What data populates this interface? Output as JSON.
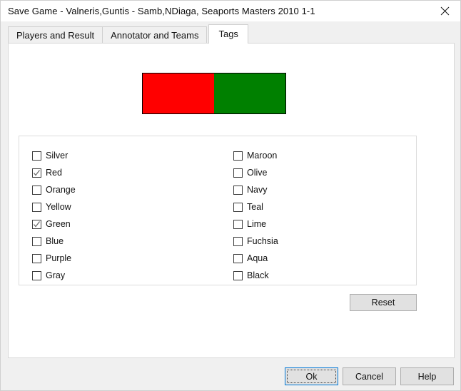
{
  "window": {
    "title": "Save Game - Valneris,Guntis - Samb,NDiaga, Seaports Masters 2010 1-1",
    "close_icon": "close-icon"
  },
  "tabs": [
    {
      "label": "Players and Result",
      "selected": false
    },
    {
      "label": "Annotator and Teams",
      "selected": false
    },
    {
      "label": "Tags",
      "selected": true
    }
  ],
  "preview": {
    "left_color": "#FF0000",
    "right_color": "#008000",
    "border_color": "#000000"
  },
  "tag_group": {
    "columns": [
      {
        "name": "left",
        "items": [
          {
            "label": "Silver",
            "checked": false
          },
          {
            "label": "Red",
            "checked": true
          },
          {
            "label": "Orange",
            "checked": false
          },
          {
            "label": "Yellow",
            "checked": false
          },
          {
            "label": "Green",
            "checked": true
          },
          {
            "label": "Blue",
            "checked": false
          },
          {
            "label": "Purple",
            "checked": false
          },
          {
            "label": "Gray",
            "checked": false
          }
        ]
      },
      {
        "name": "right",
        "items": [
          {
            "label": "Maroon",
            "checked": false
          },
          {
            "label": "Olive",
            "checked": false
          },
          {
            "label": "Navy",
            "checked": false
          },
          {
            "label": "Teal",
            "checked": false
          },
          {
            "label": "Lime",
            "checked": false
          },
          {
            "label": "Fuchsia",
            "checked": false
          },
          {
            "label": "Aqua",
            "checked": false
          },
          {
            "label": "Black",
            "checked": false
          }
        ]
      }
    ],
    "reset_label": "Reset"
  },
  "buttons": {
    "ok_label": "Ok",
    "cancel_label": "Cancel",
    "help_label": "Help",
    "focus_accent": "#0078D7"
  }
}
